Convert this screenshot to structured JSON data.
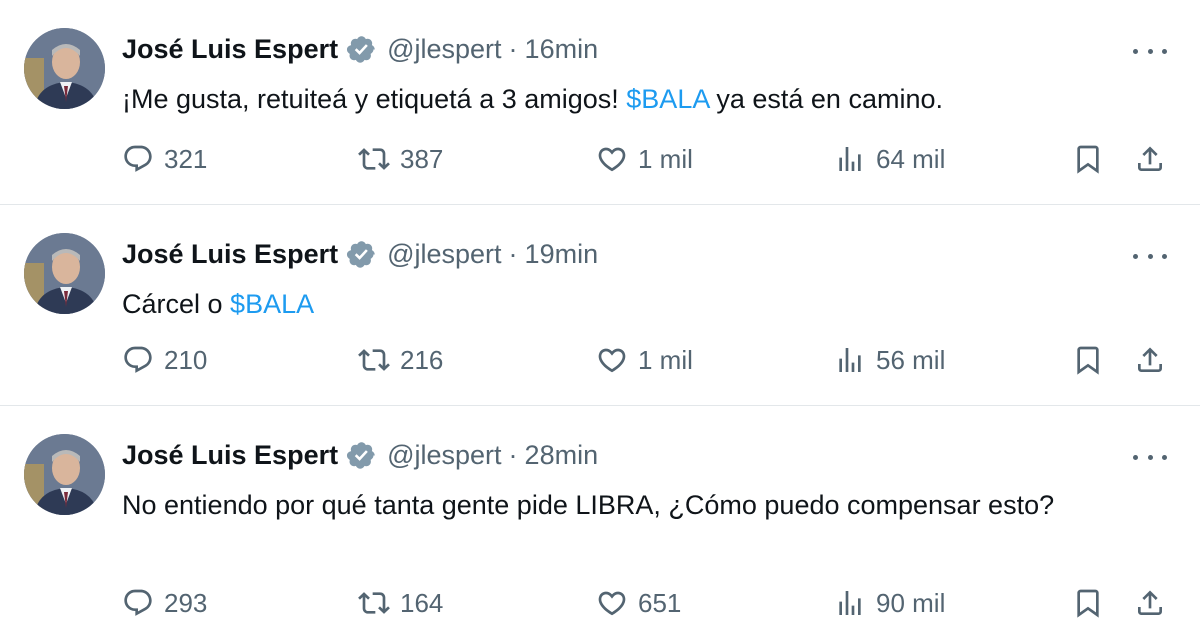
{
  "tweets": [
    {
      "author": "José Luis Espert",
      "handle": "@jlespert",
      "separator": "·",
      "time": "16min",
      "text_parts": [
        {
          "text": "¡Me gusta, retuiteá y etiquetá a 3 amigos! ",
          "style": "plain"
        },
        {
          "text": "$BALA",
          "style": "cashtag"
        },
        {
          "text": " ya está en camino.",
          "style": "plain"
        }
      ],
      "replies": "321",
      "retweets": "387",
      "likes": "1 mil",
      "views": "64 mil"
    },
    {
      "author": "José Luis Espert",
      "handle": "@jlespert",
      "separator": "·",
      "time": "19min",
      "text_parts": [
        {
          "text": "Cárcel o ",
          "style": "plain"
        },
        {
          "text": "$BALA",
          "style": "cashtag"
        }
      ],
      "replies": "210",
      "retweets": "216",
      "likes": "1 mil",
      "views": "56 mil"
    },
    {
      "author": "José Luis Espert",
      "handle": "@jlespert",
      "separator": "·",
      "time": "28min",
      "text_parts": [
        {
          "text": "No entiendo por qué tanta gente pide LIBRA, ¿Cómo puedo compensar esto?",
          "style": "plain"
        }
      ],
      "replies": "293",
      "retweets": "164",
      "likes": "651",
      "views": "90 mil"
    }
  ],
  "colors": {
    "text": "#0f1419",
    "muted": "#536471",
    "cashtag": "#1d9bf0",
    "verified_badge": "#829aab",
    "divider": "#e3e7ea"
  },
  "icons": {
    "reply": "reply-icon",
    "retweet": "retweet-icon",
    "like": "heart-icon",
    "views": "views-icon",
    "bookmark": "bookmark-icon",
    "share": "share-icon",
    "more": "more-icon",
    "verified": "verified-badge-icon"
  }
}
